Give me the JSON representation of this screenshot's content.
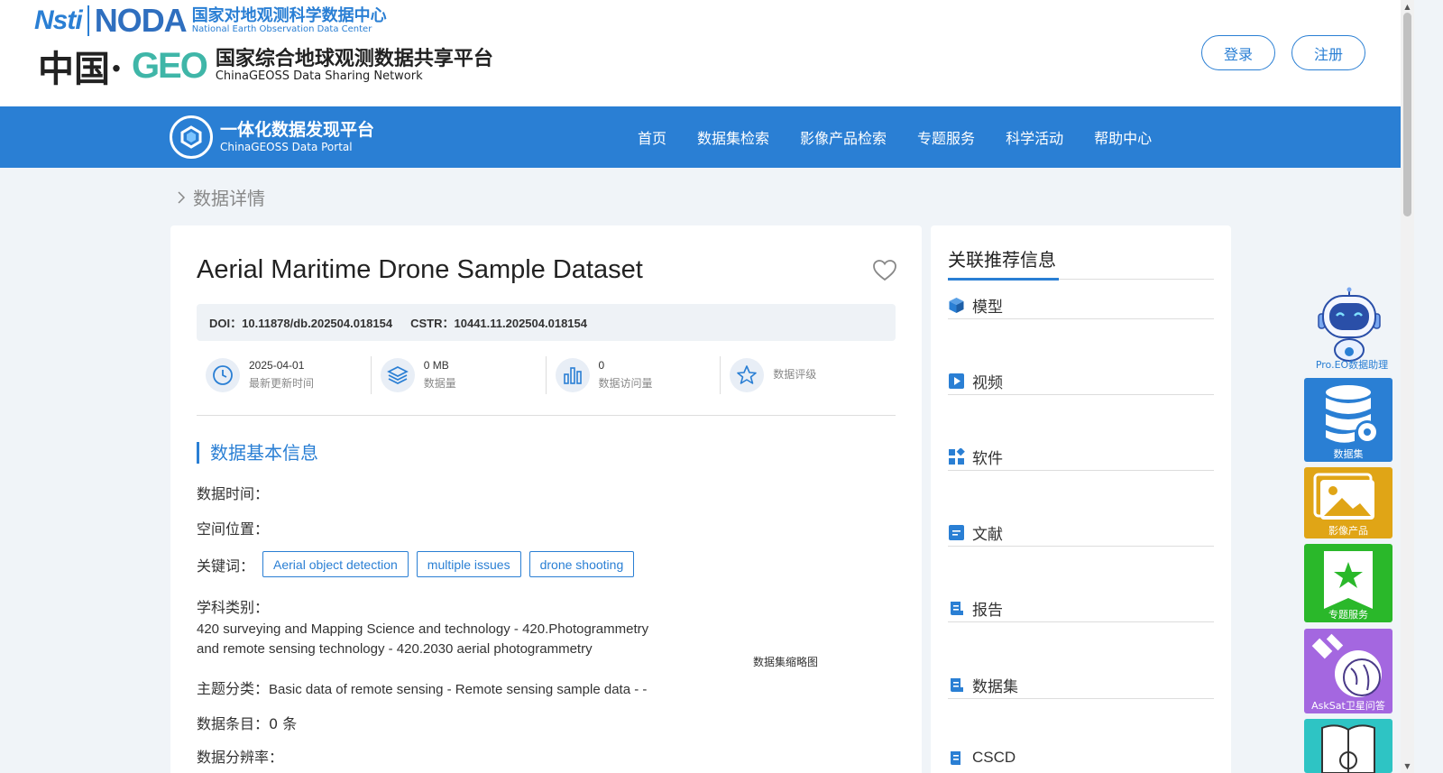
{
  "header": {
    "logo_nsti": "Nsti",
    "logo_noda": "NODA",
    "noda_cn": "国家对地观测科学数据中心",
    "noda_en": "National Earth Observation Data Center",
    "logo_zg": "中国·",
    "logo_geo": "GEO",
    "geo_cn": "国家综合地球观测数据共享平台",
    "geo_en": "ChinaGEOSS Data Sharing Network",
    "login_label": "登录",
    "register_label": "注册"
  },
  "nav": {
    "portal_cn": "一体化数据发现平台",
    "portal_en": "ChinaGEOSS Data Portal",
    "items": [
      "首页",
      "数据集检索",
      "影像产品检索",
      "专题服务",
      "科学活动",
      "帮助中心"
    ]
  },
  "breadcrumb": {
    "current": "数据详情"
  },
  "dataset": {
    "title": "Aerial Maritime Drone Sample Dataset",
    "doi_label": "DOI：",
    "doi": "10.11878/db.202504.018154",
    "cstr_label": "CSTR：",
    "cstr": "10441.11.202504.018154",
    "stats": [
      {
        "value": "2025-04-01",
        "label": "最新更新时间",
        "icon": "clock-icon"
      },
      {
        "value": "0 MB",
        "label": "数据量",
        "icon": "layers-icon"
      },
      {
        "value": "0",
        "label": "数据访问量",
        "icon": "bar-chart-icon"
      },
      {
        "value": "",
        "label": "数据评级",
        "icon": "star-icon"
      }
    ],
    "section_title": "数据基本信息",
    "data_time_label": "数据时间：",
    "space_label": "空间位置：",
    "keywords_label": "关键词：",
    "keywords": [
      "Aerial object detection",
      "multiple issues",
      "drone shooting"
    ],
    "subject_label": "学科类别：",
    "subject_value": "420 surveying and Mapping Science and technology - 420.Photogrammetry and remote sensing technology - 420.2030 aerial photogrammetry",
    "theme_label": "主题分类：",
    "theme_value": "Basic data of remote sensing - Remote sensing sample data - -",
    "entries_label": "数据条目：",
    "entries_value": "0 条",
    "resolution_label": "数据分辨率：",
    "thumbnail_label": "数据集缩略图"
  },
  "related": {
    "title": "关联推荐信息",
    "items": [
      "模型",
      "视频",
      "软件",
      "文献",
      "报告",
      "数据集",
      "CSCD"
    ]
  },
  "widgets": {
    "assistant": "Pro.EO数据助理",
    "dataset": "数据集",
    "image": "影像产品",
    "topic": "专题服务",
    "asksat": "AskSat卫星问答"
  },
  "colors": {
    "primary": "#2a7fd4",
    "dataset_widget": "#2a7fd4",
    "image_widget": "#e0a516",
    "topic_widget": "#2ab82a",
    "asksat_widget": "#a467e0",
    "book_widget": "#2ec4c4"
  }
}
